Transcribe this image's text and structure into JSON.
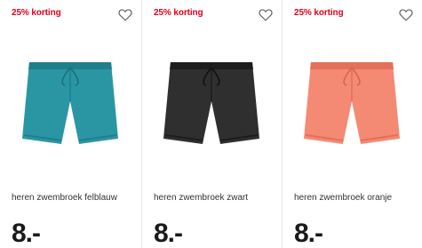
{
  "products": [
    {
      "badge": "25% korting",
      "title": "heren zwembroek felblauw",
      "price": "8.-",
      "color": "#2b96a3",
      "shade": "#1f7f8b"
    },
    {
      "badge": "25% korting",
      "title": "heren zwembroek zwart",
      "price": "8.-",
      "color": "#2f2f2f",
      "shade": "#1d1d1d"
    },
    {
      "badge": "25% korting",
      "title": "heren zwembroek oranje",
      "price": "8.-",
      "color": "#f48a74",
      "shade": "#e2705a"
    }
  ],
  "icons": {
    "favorite": "heart-outline-icon"
  }
}
